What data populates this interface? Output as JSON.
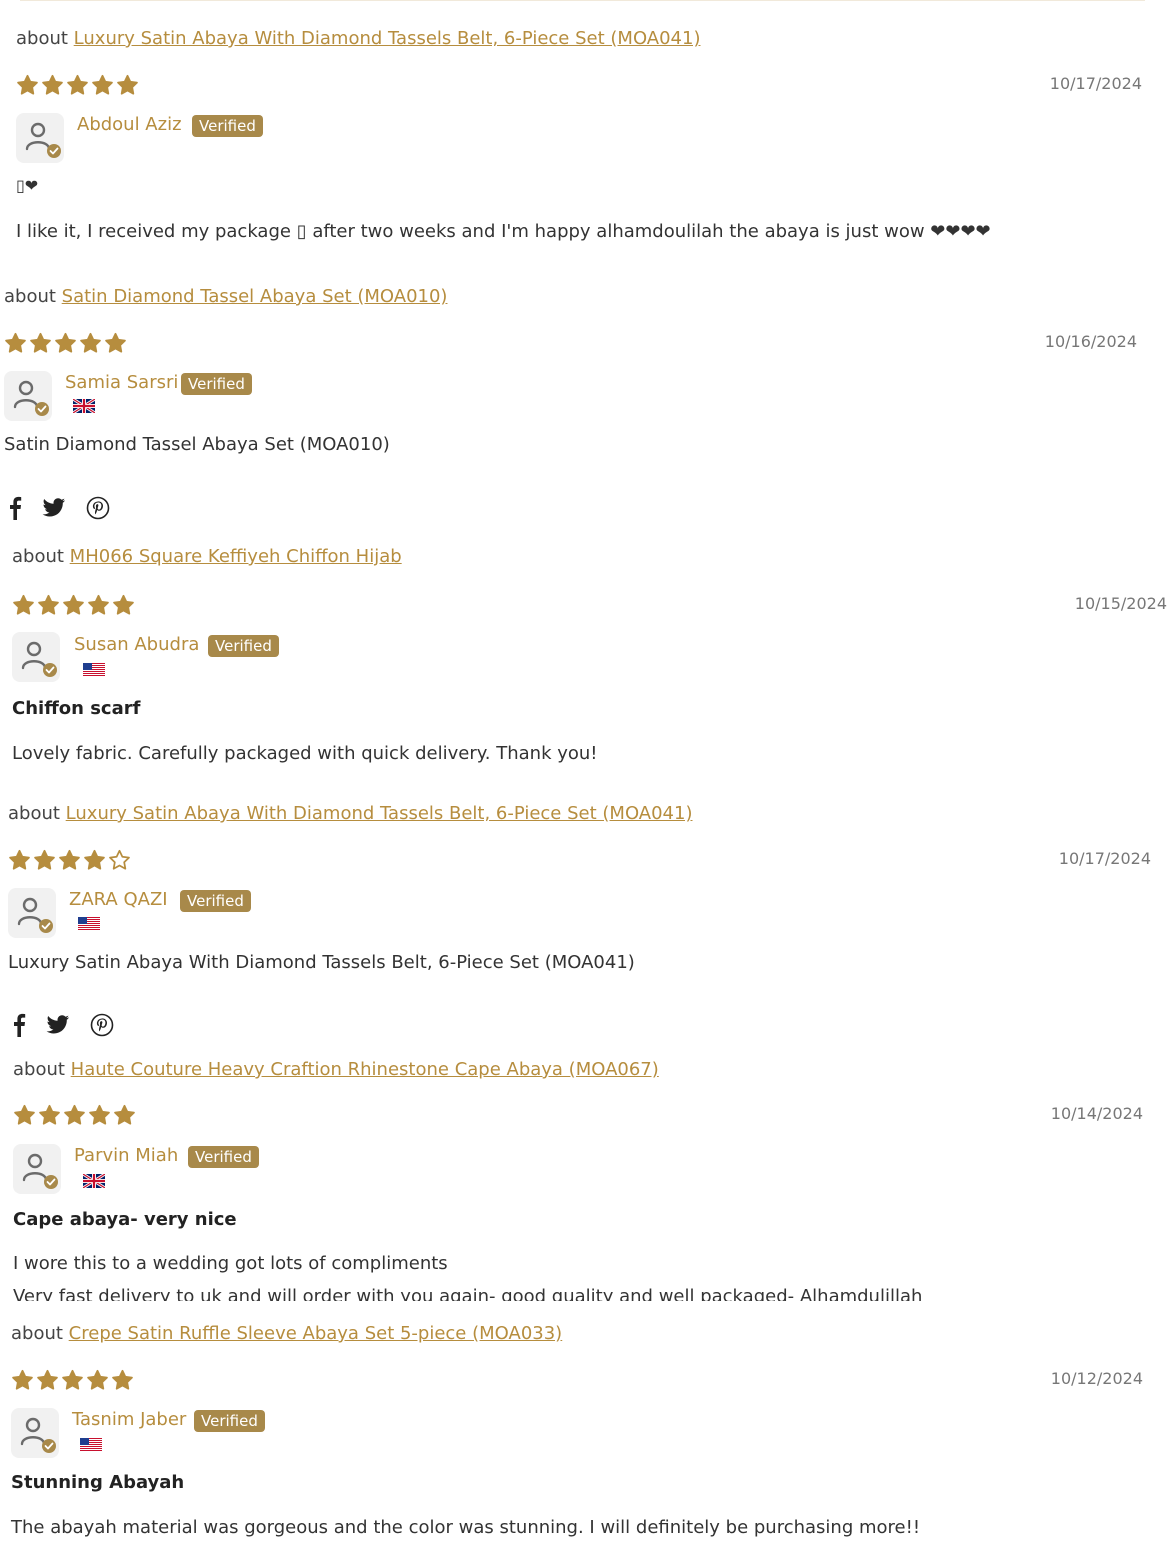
{
  "about_prefix": "about",
  "verified_label": "Verified",
  "colors": {
    "accent": "#b68d3e",
    "badge": "#a8894a",
    "star": "#b68d3e"
  },
  "reviews": [
    {
      "product": "Luxury Satin Abaya With Diamond Tassels Belt, 6-Piece Set (MOA041)",
      "rating": 5,
      "date": "10/17/2024",
      "author": "Abdoul Aziz",
      "country_flag": null,
      "title": "▯❤",
      "body": "I like it, I received my package ▯ after two weeks and I'm happy alhamdoulilah the abaya is just wow ❤❤❤❤"
    },
    {
      "product": "Satin Diamond Tassel Abaya Set (MOA010)",
      "rating": 5,
      "date": "10/16/2024",
      "author": "Samia Sarsri",
      "country_flag": "gb-flag-icon",
      "title": null,
      "body": "Satin Diamond Tassel Abaya Set (MOA010)",
      "social": [
        "facebook-icon",
        "twitter-icon",
        "pinterest-icon"
      ]
    },
    {
      "product": "MH066 Square Keffiyeh Chiffon Hijab",
      "rating": 5,
      "date": "10/15/2024",
      "author": "Susan Abudra",
      "country_flag": "us-flag-icon",
      "title": "Chiffon scarf",
      "body": "Lovely fabric. Carefully packaged with quick delivery. Thank you!"
    },
    {
      "product": "Luxury Satin Abaya With Diamond Tassels Belt, 6-Piece Set (MOA041)",
      "rating": 4,
      "date": "10/17/2024",
      "author": "ZARA QAZI",
      "country_flag": "us-flag-icon",
      "title": null,
      "body": "Luxury Satin Abaya With Diamond Tassels Belt, 6-Piece Set (MOA041)",
      "social": [
        "facebook-icon",
        "twitter-icon",
        "pinterest-icon"
      ]
    },
    {
      "product": "Haute Couture Heavy Craftion Rhinestone Cape Abaya (MOA067)",
      "rating": 5,
      "date": "10/14/2024",
      "author": "Parvin Miah",
      "country_flag": "gb-flag-icon",
      "title": "Cape abaya- very nice",
      "body": "I wore this to a wedding got lots of compliments",
      "body2": "Very fast delivery to uk and will order with you again- good quality and well packaged- Alhamdulillah"
    },
    {
      "product": "Crepe Satin Ruffle Sleeve Abaya Set 5-piece (MOA033)",
      "rating": 5,
      "date": "10/12/2024",
      "author": "Tasnim Jaber",
      "country_flag": "us-flag-icon",
      "title": "Stunning Abayah",
      "body": "The abayah material was gorgeous and the color was stunning. I will definitely be purchasing more!!"
    }
  ]
}
